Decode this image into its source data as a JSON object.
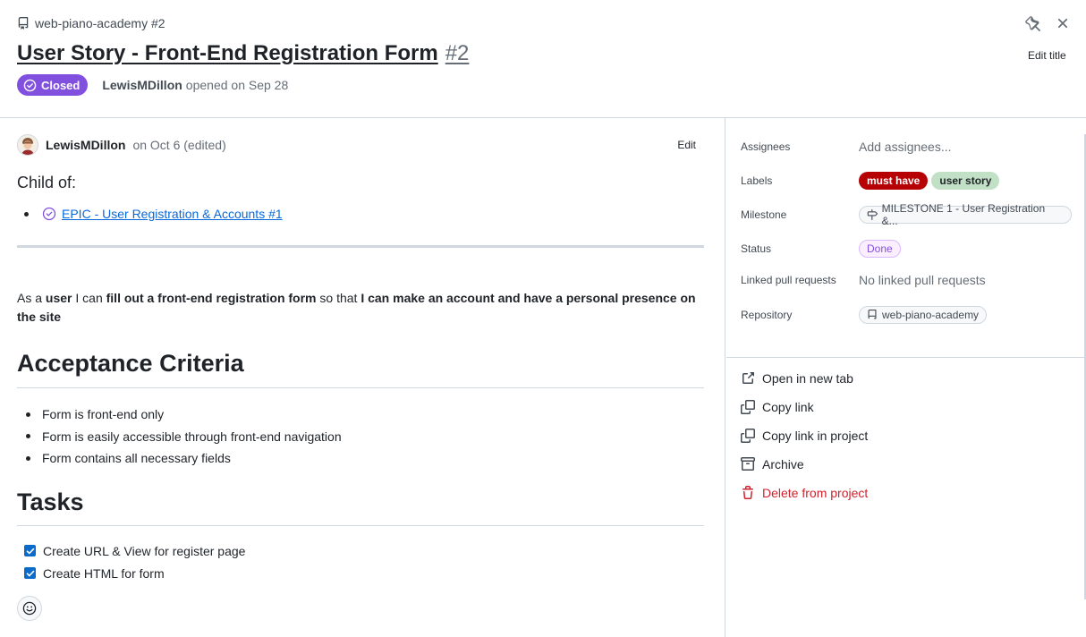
{
  "header": {
    "repo_ref": "web-piano-academy #2",
    "title": "User Story - Front-End Registration Form",
    "number": "#2",
    "edit_title": "Edit title",
    "state": "Closed",
    "author": "LewisMDillon",
    "opened": "opened on Sep 28",
    "state_color": "#8250df"
  },
  "comment": {
    "author": "LewisMDillon",
    "date": "on Oct 6 (edited)",
    "edit": "Edit",
    "child_of_heading": "Child of:",
    "child_link": "EPIC - User Registration & Accounts #1",
    "story": {
      "p1": "As a ",
      "b1": "user",
      "p2": " I can ",
      "b2": "fill out a front-end registration form",
      "p3": " so that ",
      "b3": "I can make an account and have a personal presence on the site"
    },
    "acceptance_heading": "Acceptance Criteria",
    "acceptance": [
      "Form is front-end only",
      "Form is easily accessible through front-end navigation",
      "Form contains all necessary fields"
    ],
    "tasks_heading": "Tasks",
    "tasks": [
      {
        "label": "Create URL & View for register page",
        "checked": true
      },
      {
        "label": "Create HTML for form",
        "checked": true
      }
    ]
  },
  "sidebar": {
    "assignees_label": "Assignees",
    "assignees_value": "Add assignees...",
    "labels_label": "Labels",
    "labels": [
      {
        "name": "must have",
        "color": "#b60205"
      },
      {
        "name": "user story",
        "color": "#c2e0c6"
      }
    ],
    "milestone_label": "Milestone",
    "milestone_value": "MILESTONE 1 - User Registration &...",
    "status_label": "Status",
    "status_value": "Done",
    "pr_label": "Linked pull requests",
    "pr_value": "No linked pull requests",
    "repo_label": "Repository",
    "repo_value": "web-piano-academy",
    "actions": {
      "open_new_tab": "Open in new tab",
      "copy_link": "Copy link",
      "copy_link_project": "Copy link in project",
      "archive": "Archive",
      "delete": "Delete from project"
    }
  }
}
